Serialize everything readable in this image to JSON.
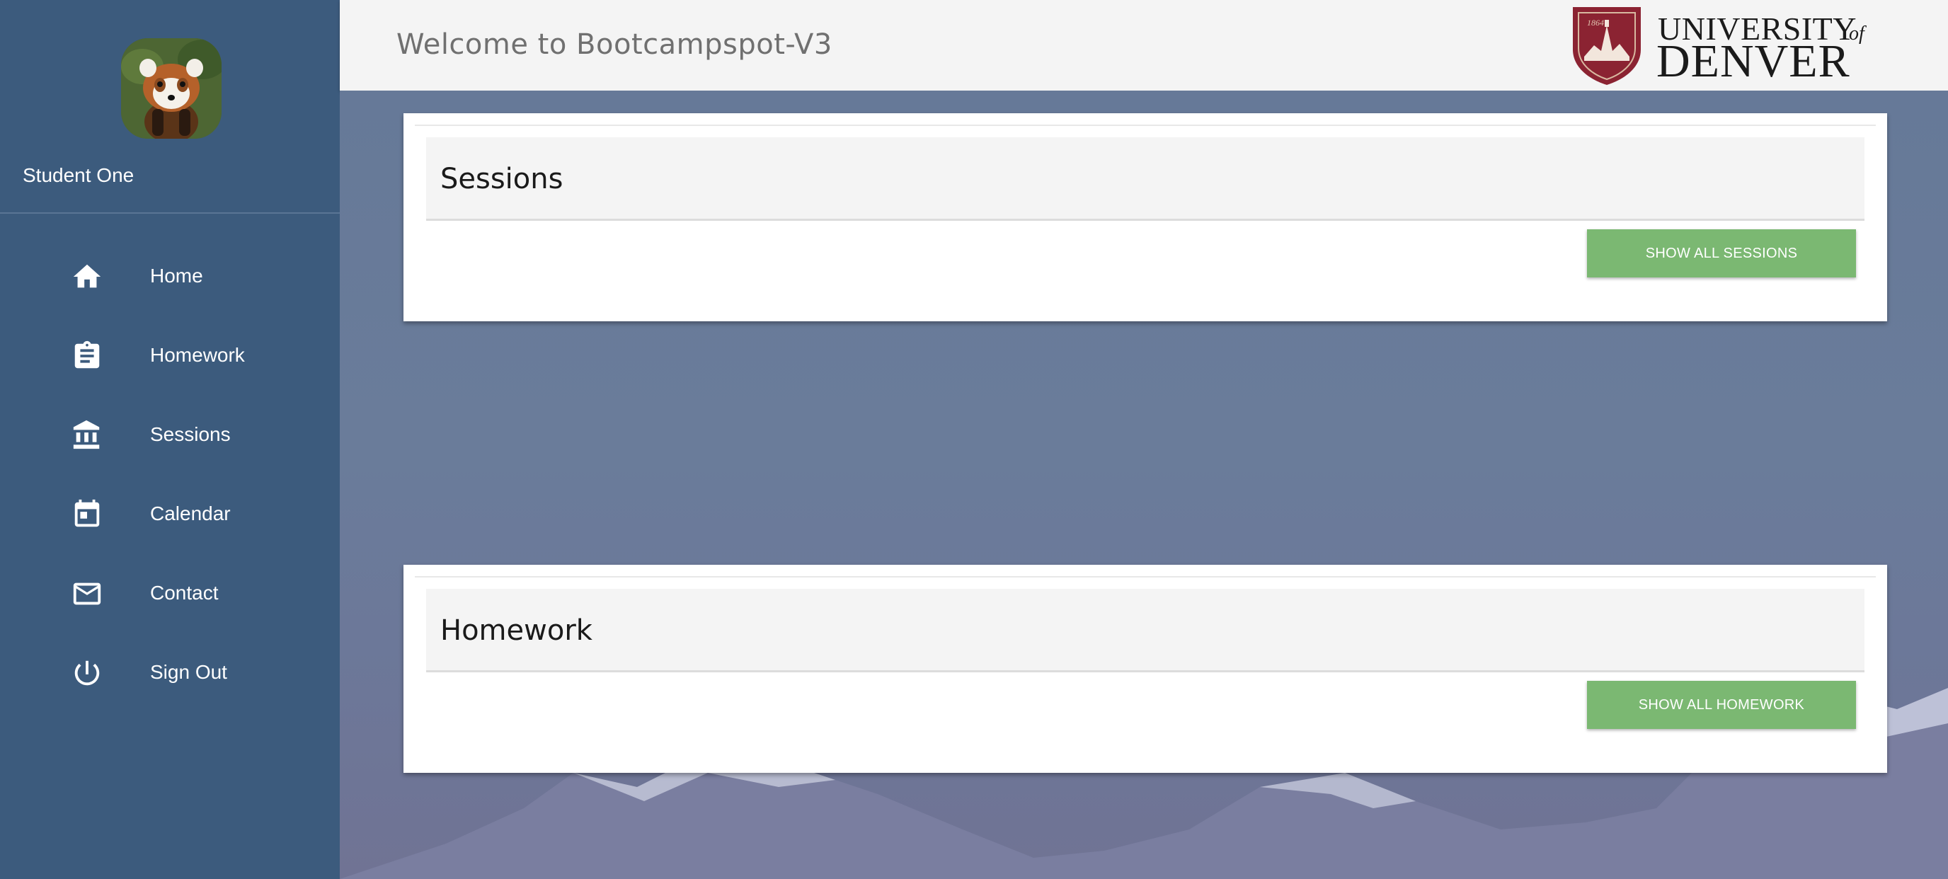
{
  "sidebar": {
    "user": {
      "name": "Student One",
      "avatar": "red-panda-photo"
    },
    "items": [
      {
        "label": "Home",
        "icon": "home-icon"
      },
      {
        "label": "Homework",
        "icon": "clipboard-icon"
      },
      {
        "label": "Sessions",
        "icon": "bank-icon"
      },
      {
        "label": "Calendar",
        "icon": "calendar-icon"
      },
      {
        "label": "Contact",
        "icon": "mail-icon"
      },
      {
        "label": "Sign Out",
        "icon": "power-icon"
      }
    ]
  },
  "header": {
    "title": "Welcome to Bootcampspot-V3",
    "logo": {
      "line1": "UNIVERSITY",
      "of": "of",
      "line2": "DENVER"
    }
  },
  "cards": [
    {
      "title": "Sessions",
      "button": "SHOW ALL SESSIONS"
    },
    {
      "title": "Homework",
      "button": "SHOW ALL HOMEWORK"
    }
  ],
  "colors": {
    "sidebar": "#3c5b7d",
    "button": "#7bb872",
    "topbar": "#f4f4f4",
    "logo_crimson": "#8b2332"
  }
}
